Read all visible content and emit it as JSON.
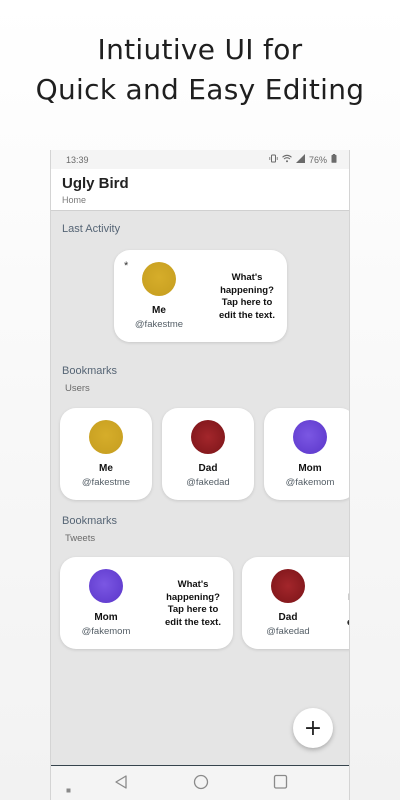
{
  "promo": {
    "line1": "Intiutive UI for",
    "line2": "Quick and Easy Editing"
  },
  "statusbar": {
    "time": "13:39",
    "battery": "76%",
    "icons": [
      "vibrate-icon",
      "wifi-icon",
      "signal-icon",
      "battery-icon"
    ]
  },
  "appbar": {
    "title": "Ugly Bird",
    "breadcrumb": "Home"
  },
  "last_activity": {
    "title": "Last Activity",
    "card": {
      "marker": "*",
      "name": "Me",
      "handle": "@fakestme",
      "text": "What's happening? Tap here to edit the text.",
      "avatar_color": "#c9a124"
    }
  },
  "bookmarks_users": {
    "title": "Bookmarks",
    "subtitle": "Users",
    "items": [
      {
        "name": "Me",
        "handle": "@fakestme",
        "avatar_color": "#c9a124"
      },
      {
        "name": "Dad",
        "handle": "@fakedad",
        "avatar_color": "#8e1d21"
      },
      {
        "name": "Mom",
        "handle": "@fakemom",
        "avatar_color": "#6a46d6"
      }
    ]
  },
  "bookmarks_tweets": {
    "title": "Bookmarks",
    "subtitle": "Tweets",
    "items": [
      {
        "name": "Mom",
        "handle": "@fakemom",
        "text": "What's happening? Tap here to edit the text.",
        "avatar_color": "#6a46d6"
      },
      {
        "name": "Dad",
        "handle": "@fakedad",
        "text": "What's happening? Tap here to edit the text.",
        "avatar_color": "#8e1d21"
      }
    ]
  },
  "fab": {
    "label": "+"
  },
  "navbar": {
    "buttons": [
      "recents-dot-icon",
      "back-icon",
      "home-icon",
      "overview-icon"
    ]
  }
}
